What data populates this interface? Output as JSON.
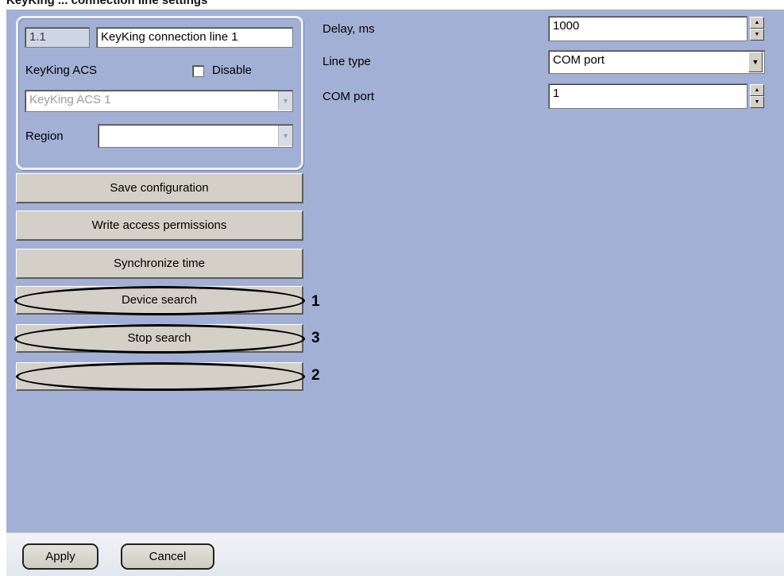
{
  "header_fragment": "KeyKing ... connection line settings",
  "object": {
    "id": "1.1",
    "name": "KeyKing connection line 1",
    "type_label": "KeyKing ACS",
    "disable_label": "Disable",
    "disable_checked": false,
    "parent_value": "KeyKing ACS 1",
    "region_label": "Region",
    "region_value": ""
  },
  "buttons": {
    "save_configuration": "Save configuration",
    "write_access_permissions": "Write access permissions",
    "synchronize_time": "Synchronize time",
    "device_search": "Device search",
    "stop_search": "Stop search",
    "progress": ""
  },
  "callouts": {
    "device_search": "1",
    "stop_search": "3",
    "progress": "2"
  },
  "settings": {
    "delay_label": "Delay, ms",
    "delay_value": "1000",
    "line_type_label": "Line type",
    "line_type_value": "COM port",
    "com_port_label": "COM port",
    "com_port_value": "1"
  },
  "footer": {
    "apply": "Apply",
    "cancel": "Cancel"
  },
  "colors": {
    "panel_bg": "#a3b0d6",
    "button_face": "#d4d0c8"
  }
}
